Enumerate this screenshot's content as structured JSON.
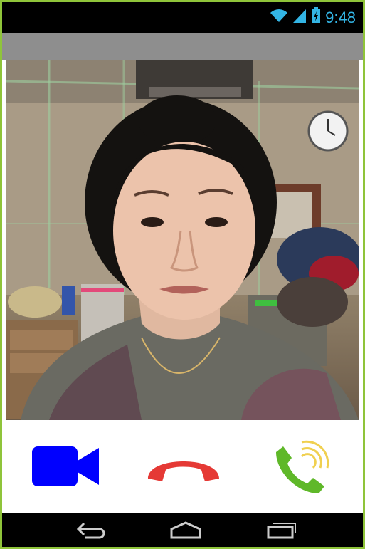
{
  "status_bar": {
    "time": "9:48",
    "icons": [
      "wifi-icon",
      "signal-icon",
      "battery-icon"
    ]
  },
  "video": {
    "description_icon": "remote-video-feed"
  },
  "call_controls": {
    "video_button": {
      "icon": "video-camera-icon",
      "color": "#0000ff"
    },
    "hangup_button": {
      "icon": "hang-up-phone-icon",
      "color": "#e53935"
    },
    "answer_button": {
      "icon": "answer-phone-icon",
      "color": "#5fb829"
    }
  },
  "nav_bar": {
    "icons": [
      "back-icon",
      "home-icon",
      "recents-icon"
    ]
  },
  "colors": {
    "frame": "#8fc43a",
    "status_accent": "#33b5e5",
    "toolbar": "#8e8e8e"
  }
}
